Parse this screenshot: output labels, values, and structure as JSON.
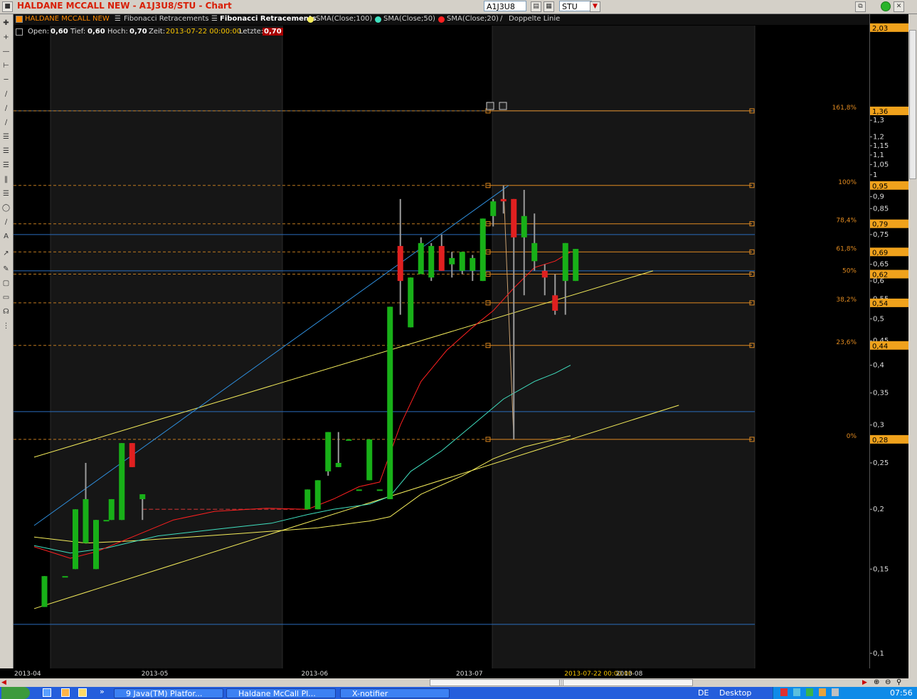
{
  "window": {
    "title": "HALDANE MCCALL NEW - A1J3U8/STU - Chart",
    "symbol_value": "A1J3U8",
    "exchange_value": "STU"
  },
  "legend": [
    {
      "label": "HALDANE MCCALL NEW",
      "color": "#ff8a00"
    },
    {
      "label": "Fibonacci Retracements",
      "color": "#cfcfcf"
    },
    {
      "label": "Fibonacci Retracements",
      "color": "#ffffff"
    },
    {
      "label": "SMA(Close;100)",
      "color": "#f5ed5b"
    },
    {
      "label": "SMA(Close;50)",
      "color": "#40e0c0"
    },
    {
      "label": "SMA(Close;20)",
      "color": "#ff2020"
    },
    {
      "label": "Doppelte Linie",
      "color": "#cfcfcf"
    }
  ],
  "ohlc": {
    "open_label": "Open:",
    "open": "0,60",
    "low_label": "Tief:",
    "low": "0,60",
    "high_label": "Hoch:",
    "high": "0,70",
    "time_label": "Zeit:",
    "time": "2013-07-22 00:00:00",
    "last_label": "Letzte:",
    "last": "0,70"
  },
  "taskbar": {
    "items": [
      "9 Java(TM) Platfor...",
      "Haldane McCall Pl...",
      "X-notifier"
    ],
    "lang": "DE",
    "desktop": "Desktop",
    "clock": "07:56"
  },
  "chart_data": {
    "type": "candlestick",
    "y_scale": "log",
    "ylim": [
      0.093,
      2.05
    ],
    "y_ticks": [
      {
        "v": 1.3,
        "t": "1,3"
      },
      {
        "v": 1.2,
        "t": "1,2"
      },
      {
        "v": 1.15,
        "t": "1,15"
      },
      {
        "v": 1.1,
        "t": "1,1"
      },
      {
        "v": 1.05,
        "t": "1,05"
      },
      {
        "v": 1.0,
        "t": "1"
      },
      {
        "v": 0.9,
        "t": "0,9"
      },
      {
        "v": 0.85,
        "t": "0,85"
      },
      {
        "v": 0.75,
        "t": "0,75"
      },
      {
        "v": 0.65,
        "t": "0,65"
      },
      {
        "v": 0.6,
        "t": "0,6"
      },
      {
        "v": 0.55,
        "t": "0,55"
      },
      {
        "v": 0.5,
        "t": "0,5"
      },
      {
        "v": 0.45,
        "t": "0,45"
      },
      {
        "v": 0.4,
        "t": "0,4"
      },
      {
        "v": 0.35,
        "t": "0,35"
      },
      {
        "v": 0.3,
        "t": "0,3"
      },
      {
        "v": 0.25,
        "t": "0,25"
      },
      {
        "v": 0.2,
        "t": "0,2"
      },
      {
        "v": 0.15,
        "t": "0,15"
      },
      {
        "v": 0.1,
        "t": "0,1"
      }
    ],
    "price_tags": [
      {
        "v": 2.03,
        "t": "2,03"
      },
      {
        "v": 1.36,
        "t": "1,36"
      },
      {
        "v": 0.95,
        "t": "0,95"
      },
      {
        "v": 0.79,
        "t": "0,79"
      },
      {
        "v": 0.69,
        "t": "0,69"
      },
      {
        "v": 0.62,
        "t": "0,62"
      },
      {
        "v": 0.54,
        "t": "0,54"
      },
      {
        "v": 0.44,
        "t": "0,44"
      },
      {
        "v": 0.28,
        "t": "0,28"
      }
    ],
    "x_labels": [
      {
        "t": "2013-04",
        "d": 0
      },
      {
        "t": "2013-05",
        "d": 23
      },
      {
        "t": "2013-06",
        "d": 54
      },
      {
        "t": "2013-07",
        "d": 84
      },
      {
        "t": "2013-07-22 00:00:00",
        "d": 105,
        "highlight": true
      },
      {
        "t": "2013-08",
        "d": 115
      }
    ],
    "fib_levels": [
      {
        "label": "161,8%",
        "v": 1.36
      },
      {
        "label": "100%",
        "v": 0.95
      },
      {
        "label": "78,4%",
        "v": 0.79
      },
      {
        "label": "61,8%",
        "v": 0.69
      },
      {
        "label": "50%",
        "v": 0.62
      },
      {
        "label": "38,2%",
        "v": 0.54
      },
      {
        "label": "23,6%",
        "v": 0.44
      },
      {
        "label": "0%",
        "v": 0.28
      }
    ],
    "candles": [
      {
        "d": 2,
        "o": 0.125,
        "h": 0.145,
        "l": 0.125,
        "c": 0.145
      },
      {
        "d": 6,
        "o": 0.145,
        "h": 0.145,
        "l": 0.145,
        "c": 0.145
      },
      {
        "d": 8,
        "o": 0.15,
        "h": 0.2,
        "l": 0.15,
        "c": 0.2
      },
      {
        "d": 10,
        "o": 0.17,
        "h": 0.25,
        "l": 0.17,
        "c": 0.21
      },
      {
        "d": 12,
        "o": 0.15,
        "h": 0.19,
        "l": 0.15,
        "c": 0.19
      },
      {
        "d": 14,
        "o": 0.19,
        "h": 0.19,
        "l": 0.19,
        "c": 0.19
      },
      {
        "d": 15,
        "o": 0.19,
        "h": 0.21,
        "l": 0.19,
        "c": 0.21
      },
      {
        "d": 17,
        "o": 0.19,
        "h": 0.275,
        "l": 0.19,
        "c": 0.275
      },
      {
        "d": 19,
        "o": 0.275,
        "h": 0.275,
        "l": 0.245,
        "c": 0.245
      },
      {
        "d": 21,
        "o": 0.21,
        "h": 0.215,
        "l": 0.19,
        "c": 0.215
      },
      {
        "d": 53,
        "o": 0.2,
        "h": 0.22,
        "l": 0.2,
        "c": 0.22
      },
      {
        "d": 55,
        "o": 0.2,
        "h": 0.23,
        "l": 0.2,
        "c": 0.23
      },
      {
        "d": 57,
        "o": 0.24,
        "h": 0.29,
        "l": 0.235,
        "c": 0.29
      },
      {
        "d": 59,
        "o": 0.245,
        "h": 0.29,
        "l": 0.245,
        "c": 0.25
      },
      {
        "d": 61,
        "o": 0.28,
        "h": 0.28,
        "l": 0.28,
        "c": 0.28
      },
      {
        "d": 63,
        "o": 0.22,
        "h": 0.22,
        "l": 0.22,
        "c": 0.22
      },
      {
        "d": 65,
        "o": 0.23,
        "h": 0.28,
        "l": 0.23,
        "c": 0.28
      },
      {
        "d": 67,
        "o": 0.22,
        "h": 0.22,
        "l": 0.22,
        "c": 0.22
      },
      {
        "d": 69,
        "o": 0.21,
        "h": 0.53,
        "l": 0.21,
        "c": 0.53
      },
      {
        "d": 71,
        "o": 0.71,
        "h": 0.89,
        "l": 0.51,
        "c": 0.6
      },
      {
        "d": 73,
        "o": 0.48,
        "h": 0.61,
        "l": 0.48,
        "c": 0.61
      },
      {
        "d": 75,
        "o": 0.62,
        "h": 0.74,
        "l": 0.62,
        "c": 0.72
      },
      {
        "d": 77,
        "o": 0.61,
        "h": 0.72,
        "l": 0.6,
        "c": 0.71
      },
      {
        "d": 79,
        "o": 0.71,
        "h": 0.75,
        "l": 0.63,
        "c": 0.63
      },
      {
        "d": 81,
        "o": 0.65,
        "h": 0.69,
        "l": 0.61,
        "c": 0.67
      },
      {
        "d": 83,
        "o": 0.63,
        "h": 0.69,
        "l": 0.62,
        "c": 0.69
      },
      {
        "d": 85,
        "o": 0.63,
        "h": 0.68,
        "l": 0.6,
        "c": 0.67
      },
      {
        "d": 87,
        "o": 0.6,
        "h": 0.81,
        "l": 0.6,
        "c": 0.81
      },
      {
        "d": 89,
        "o": 0.82,
        "h": 0.89,
        "l": 0.78,
        "c": 0.88
      },
      {
        "d": 91,
        "o": 0.89,
        "h": 0.95,
        "l": 0.83,
        "c": 0.88
      },
      {
        "d": 93,
        "o": 0.89,
        "h": 0.89,
        "l": 0.28,
        "c": 0.74
      },
      {
        "d": 95,
        "o": 0.74,
        "h": 0.93,
        "l": 0.56,
        "c": 0.82
      },
      {
        "d": 97,
        "o": 0.66,
        "h": 0.83,
        "l": 0.63,
        "c": 0.72
      },
      {
        "d": 99,
        "o": 0.63,
        "h": 0.65,
        "l": 0.56,
        "c": 0.61
      },
      {
        "d": 101,
        "o": 0.56,
        "h": 0.62,
        "l": 0.51,
        "c": 0.52
      },
      {
        "d": 103,
        "o": 0.6,
        "h": 0.72,
        "l": 0.51,
        "c": 0.72
      },
      {
        "d": 105,
        "o": 0.6,
        "h": 0.7,
        "l": 0.6,
        "c": 0.7
      }
    ],
    "sma20": [
      [
        0,
        0.167
      ],
      [
        7,
        0.158
      ],
      [
        12,
        0.163
      ],
      [
        19,
        0.175
      ],
      [
        27,
        0.19
      ],
      [
        35,
        0.198
      ],
      [
        45,
        0.201
      ],
      [
        53,
        0.2
      ],
      [
        58,
        0.21
      ],
      [
        63,
        0.223
      ],
      [
        67,
        0.228
      ],
      [
        71,
        0.3
      ],
      [
        75,
        0.37
      ],
      [
        80,
        0.43
      ],
      [
        85,
        0.48
      ],
      [
        89,
        0.52
      ],
      [
        93,
        0.58
      ],
      [
        97,
        0.64
      ],
      [
        101,
        0.66
      ],
      [
        104,
        0.69
      ]
    ],
    "sma50": [
      [
        0,
        0.168
      ],
      [
        7,
        0.162
      ],
      [
        14,
        0.166
      ],
      [
        24,
        0.176
      ],
      [
        36,
        0.182
      ],
      [
        46,
        0.187
      ],
      [
        53,
        0.195
      ],
      [
        58,
        0.2
      ],
      [
        65,
        0.205
      ],
      [
        69,
        0.213
      ],
      [
        73,
        0.24
      ],
      [
        79,
        0.265
      ],
      [
        85,
        0.3
      ],
      [
        91,
        0.34
      ],
      [
        97,
        0.37
      ],
      [
        101,
        0.385
      ],
      [
        104,
        0.4
      ]
    ],
    "sma100": [
      [
        0,
        0.175
      ],
      [
        10,
        0.17
      ],
      [
        20,
        0.172
      ],
      [
        40,
        0.178
      ],
      [
        55,
        0.183
      ],
      [
        65,
        0.189
      ],
      [
        69,
        0.193
      ],
      [
        75,
        0.215
      ],
      [
        83,
        0.235
      ],
      [
        89,
        0.255
      ],
      [
        95,
        0.27
      ],
      [
        104,
        0.285
      ]
    ],
    "trend_lines": [
      {
        "color": "#f5ed5b",
        "from": [
          0,
          0.257
        ],
        "to": [
          120,
          0.63
        ]
      },
      {
        "color": "#f5ed5b",
        "from": [
          0,
          0.124
        ],
        "to": [
          125,
          0.33
        ]
      },
      {
        "color": "#2e8ddb",
        "from": [
          0,
          0.185
        ],
        "to": [
          92,
          0.95
        ]
      },
      {
        "color": "#c8a070",
        "from": [
          91,
          0.95
        ],
        "to": [
          93,
          0.28
        ]
      }
    ],
    "h_lines": [
      {
        "v": 1.36,
        "color": "#5a6b80"
      },
      {
        "v": 0.75,
        "color": "#2a6dbd"
      },
      {
        "v": 0.63,
        "color": "#2a6dbd"
      },
      {
        "v": 0.32,
        "color": "#2a6dbd"
      },
      {
        "v": 0.115,
        "color": "#2a6dbd"
      }
    ],
    "support_dashed": {
      "v": 0.2,
      "from": 21,
      "to": 53,
      "color": "#c03030"
    }
  }
}
